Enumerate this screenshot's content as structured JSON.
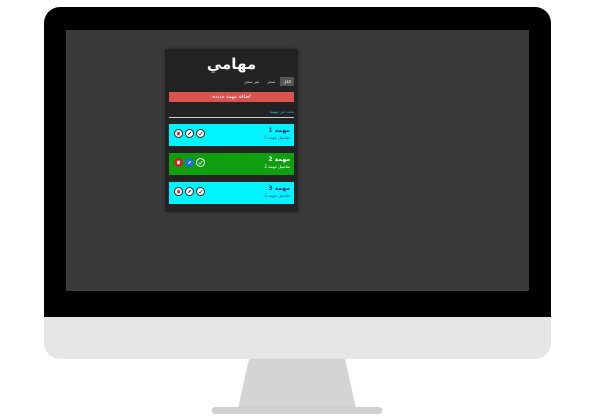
{
  "app": {
    "title": "مهامي",
    "filters": [
      {
        "label": "الكل",
        "active": true
      },
      {
        "label": "منجز",
        "active": false
      },
      {
        "label": "غير منجز",
        "active": false
      }
    ],
    "add_button_label": "اضافة مهمة جديدة",
    "search_link": "بحث عن مهمة"
  },
  "tasks": [
    {
      "title": "مهمة 1",
      "description": "تفاصيل مهمة 1",
      "done": false,
      "bg_color": "#00f4ff",
      "text_color": "#1f3a7a"
    },
    {
      "title": "مهمة 2",
      "description": "تفاصيل مهمة 2",
      "done": true,
      "bg_color": "#0e9f0e",
      "text_color": "#ffffff"
    },
    {
      "title": "مهمة 3",
      "description": "تفاصيل مهمة 3",
      "done": false,
      "bg_color": "#00f4ff",
      "text_color": "#1f3a7a"
    }
  ],
  "colors": {
    "delete": "#cc1f1f",
    "edit_pending": "#ffffff",
    "edit_done": "#1e6fd9",
    "check_done": "#ffffff"
  },
  "icons": [
    "trash-icon",
    "pencil-icon",
    "check-icon"
  ]
}
